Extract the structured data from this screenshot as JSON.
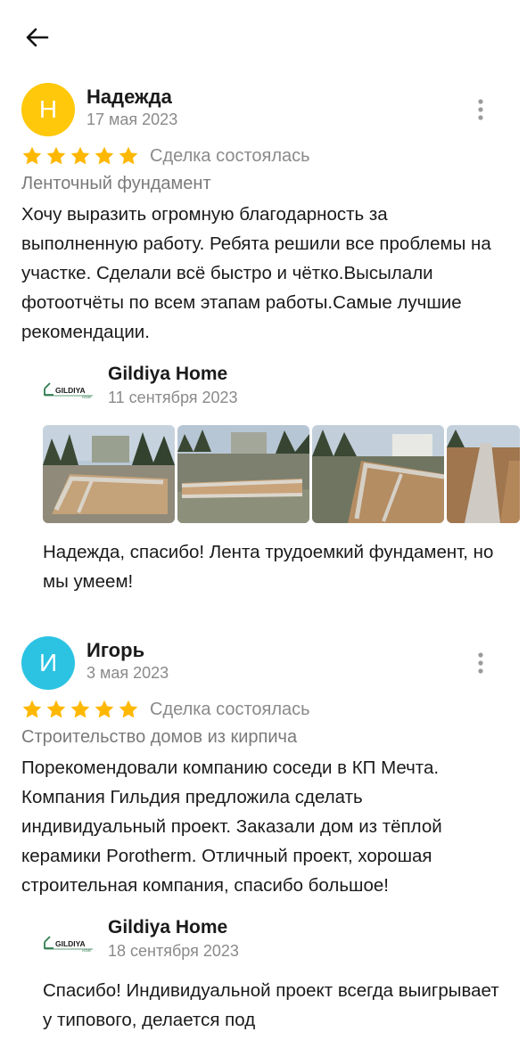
{
  "back_icon": "arrow-left-icon",
  "colors": {
    "avatar_1": "#FFC80A",
    "avatar_2": "#2CC3E3",
    "star": "#FFB800",
    "brand_green": "#2E7D4F"
  },
  "reviews": [
    {
      "avatar_letter": "Н",
      "author": "Надежда",
      "date": "17 мая 2023",
      "rating": 5,
      "deal_status": "Сделка состоялась",
      "service": "Ленточный фундамент",
      "text": "Хочу выразить огромную благодарность за выполненную работу. Ребята решили все проблемы на участке. Сделали всё быстро и чётко.Высылали фотоотчёты по всем этапам работы.Самые лучшие рекомендации.",
      "reply": {
        "logo_text": "GILDIYA",
        "logo_subtext": "HOME",
        "company": "Gildiya Home",
        "date": "11 сентября 2023",
        "photos": [
          "foundation-photo-1",
          "foundation-photo-2",
          "foundation-photo-3",
          "foundation-photo-4"
        ],
        "text": "Надежда, спасибо! Лента трудоемкий фундамент, но мы умеем!"
      }
    },
    {
      "avatar_letter": "И",
      "author": "Игорь",
      "date": "3 мая 2023",
      "rating": 5,
      "deal_status": "Сделка состоялась",
      "service": "Строительство домов из кирпича",
      "text": "Порекомендовали компанию соседи в КП Мечта. Компания Гильдия предложила сделать индивидуальный проект. Заказали дом из тёплой керамики Porotherm. Отличный проект, хорошая строительная компания, спасибо большое!",
      "reply": {
        "logo_text": "GILDIYA",
        "logo_subtext": "HOME",
        "company": "Gildiya Home",
        "date": "18 сентября 2023",
        "text": "Спасибо! Индивидуальной проект всегда выигрывает у типового, делается под"
      }
    }
  ]
}
